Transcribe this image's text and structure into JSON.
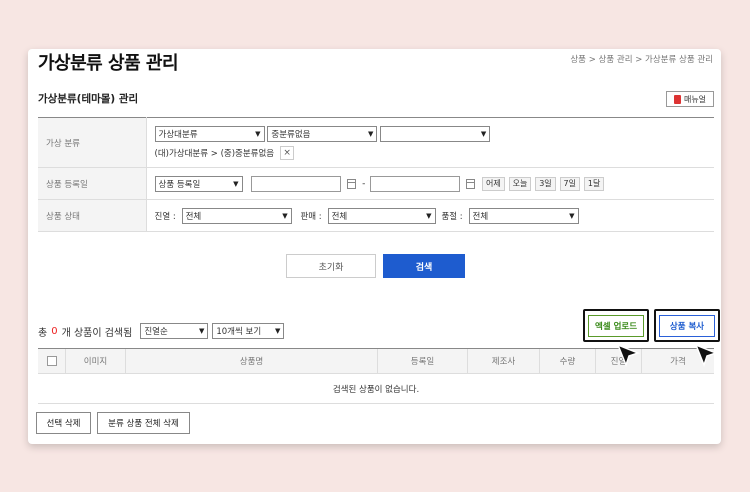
{
  "header": {
    "title": "가상분류 상품 관리",
    "breadcrumb": "상품 > 상품 관리 > 가상분류 상품 관리"
  },
  "section": {
    "title": "가상분류(테마몰) 관리",
    "manual_label": "매뉴얼"
  },
  "search": {
    "category": {
      "label": "가상 분류",
      "level1": "가상대분류",
      "level2": "중분류없음",
      "level3": "",
      "selected_path": "(대)가상대분류 > (중)중분류없음",
      "remove_label": "×"
    },
    "date": {
      "label": "상품 등록일",
      "type": "상품 등록일",
      "start": "",
      "end": "",
      "separator": "-",
      "quick_buttons": [
        "어제",
        "오늘",
        "3일",
        "7일",
        "1달"
      ]
    },
    "status": {
      "label": "상품 상태",
      "display_label": "진열 :",
      "display_value": "전체",
      "sale_label": "판매 :",
      "sale_value": "전체",
      "soldout_label": "품절 :",
      "soldout_value": "전체"
    },
    "reset_label": "초기화",
    "search_label": "검색"
  },
  "results": {
    "prefix": "총",
    "count": "0",
    "suffix": "개 상품이 검색됨",
    "sort_value": "진열순",
    "page_size_value": "10개씩 보기",
    "excel_upload_label": "엑셀 업로드",
    "copy_label": "상품 복사",
    "columns": [
      "",
      "이미지",
      "상품명",
      "등록일",
      "제조사",
      "수량",
      "진열",
      "가격"
    ],
    "empty_message": "검색된 상품이 없습니다.",
    "delete_selected_label": "선택 삭제",
    "delete_all_label": "분류 상품 전체 삭제"
  }
}
